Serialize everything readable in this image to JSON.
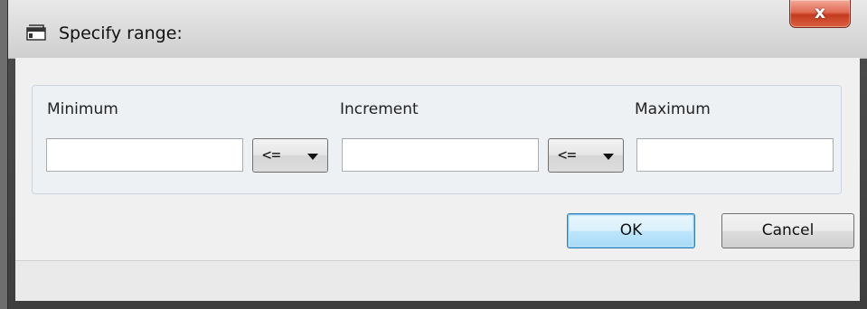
{
  "window": {
    "title": "Specify range:",
    "close_label": "x"
  },
  "range": {
    "minimum_label": "Minimum",
    "increment_label": "Increment",
    "maximum_label": "Maximum",
    "minimum_value": "",
    "increment_value": "",
    "maximum_value": "",
    "operator_left": "<=",
    "operator_right": "<="
  },
  "buttons": {
    "ok": "OK",
    "cancel": "Cancel"
  },
  "colors": {
    "close_button": "#d9603f",
    "default_button_border": "#3c7fb1"
  },
  "icons": [
    "app-window-icon",
    "close-icon",
    "dropdown-arrow-icon"
  ]
}
